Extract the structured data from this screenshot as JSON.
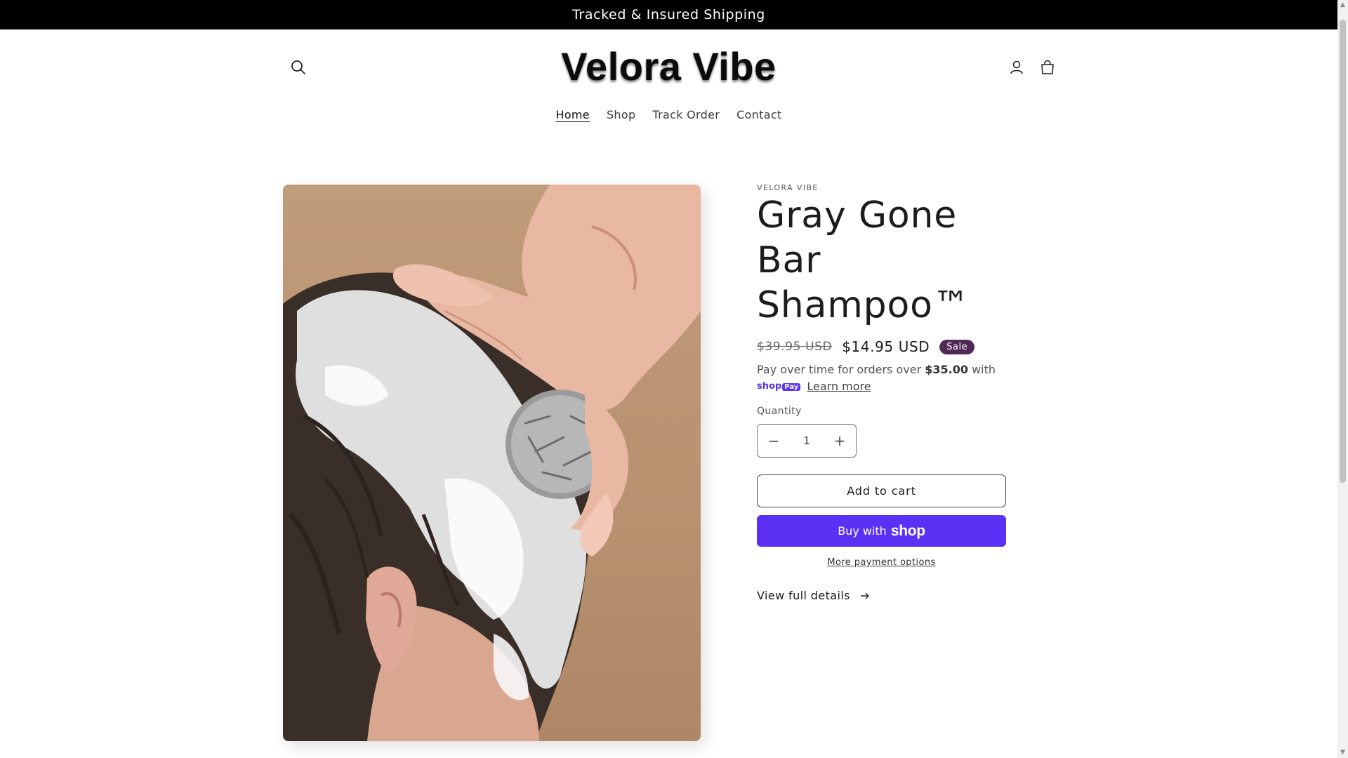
{
  "announcement": {
    "text": "Tracked & Insured Shipping"
  },
  "header": {
    "logo_text": "Velora Vibe",
    "icons": {
      "search": "search-icon",
      "account": "account-icon",
      "cart": "cart-icon"
    }
  },
  "nav": {
    "items": [
      {
        "label": "Home",
        "active": true
      },
      {
        "label": "Shop",
        "active": false
      },
      {
        "label": "Track Order",
        "active": false
      },
      {
        "label": "Contact",
        "active": false
      }
    ]
  },
  "product": {
    "vendor": "VELORA VIBE",
    "title": "Gray Gone Bar Shampoo™",
    "compare_price": "$39.95 USD",
    "price": "$14.95 USD",
    "badge": "Sale",
    "installments": {
      "text_before": "Pay over time for orders over ",
      "threshold": "$35.00",
      "text_after": " with",
      "shop_label": "shop",
      "pay_label": "Pay",
      "learn_more": "Learn more"
    },
    "quantity": {
      "label": "Quantity",
      "value": "1",
      "decrement": "−",
      "increment": "+"
    },
    "add_to_cart": "Add to cart",
    "buy_now": {
      "prefix": "Buy with",
      "brand": "shop"
    },
    "more_payment": "More payment options",
    "view_details": "View full details",
    "image_alt": "Man lathering hair with shampoo bar"
  },
  "colors": {
    "announcement_bg": "#000000",
    "shop_pay": "#5a31f4",
    "sale_badge": "#4e2a55",
    "image_bg": "#c19c7a"
  }
}
